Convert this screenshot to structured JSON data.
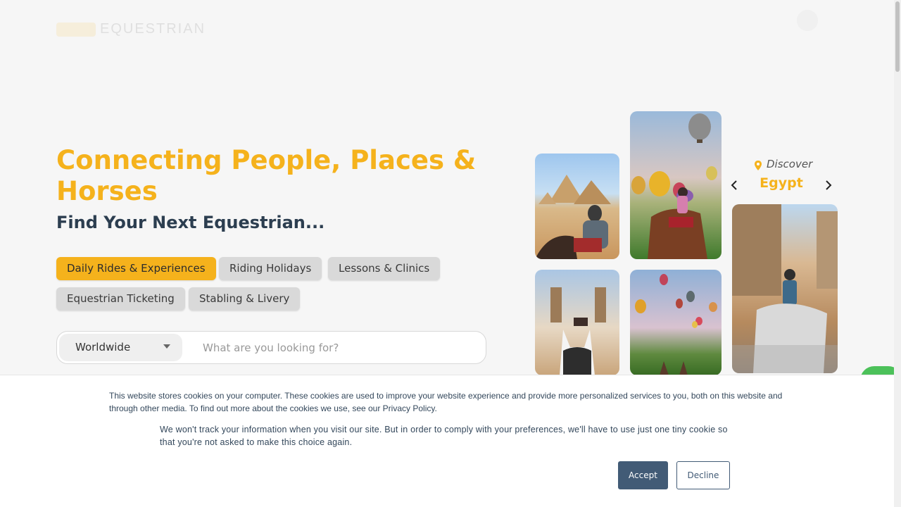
{
  "header": {
    "logo_text": "EQUESTRIAN"
  },
  "hero": {
    "title": "Connecting People, Places & Horses",
    "subtitle": "Find Your Next Equestrian..."
  },
  "categories": [
    {
      "label": "Daily Rides & Experiences",
      "active": true
    },
    {
      "label": "Riding Holidays",
      "active": false
    },
    {
      "label": "Lessons & Clinics",
      "active": false
    },
    {
      "label": "Equestrian Ticketing",
      "active": false
    },
    {
      "label": "Stabling & Livery",
      "active": false
    }
  ],
  "search": {
    "region_value": "Worldwide",
    "placeholder": "What are you looking for?"
  },
  "discover": {
    "label": "Discover",
    "destination": "Egypt"
  },
  "cookie": {
    "text_1": "This website stores cookies on your computer. These cookies are used to improve your website experience and provide more personalized services to you, both on this website and through other media. To find out more about the cookies we use, see our Privacy Policy.",
    "text_2": "We won't track your information when you visit our site. But in order to comply with your preferences, we'll have to use just one tiny cookie so that you're not asked to make this choice again.",
    "accept_label": "Accept",
    "decline_label": "Decline"
  },
  "colors": {
    "accent": "#f5b21c",
    "heading": "#2c3e50",
    "cookie_button": "#425b76",
    "chat": "#4cc15a"
  }
}
